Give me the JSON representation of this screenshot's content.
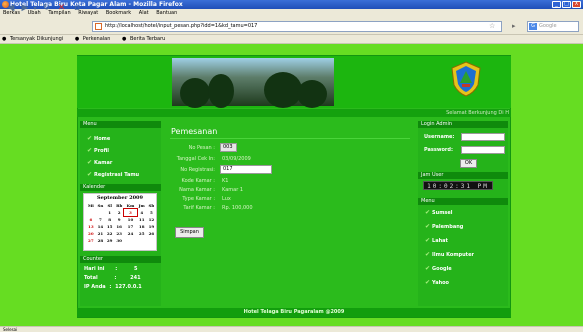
{
  "window": {
    "title": "Hotel Telaga Biru Kota Pagar Alam - Mozilla Firefox",
    "min": "_",
    "max": "□",
    "close": "X"
  },
  "menubar": [
    "Berkas",
    "Ubah",
    "Tampilan",
    "Riwayat",
    "Bookmark",
    "Alat",
    "Bantuan"
  ],
  "nav": {
    "url": "http://localhost/hotel/input_pesan.php?idd=1&kd_tamu=017",
    "search_placeholder": "Google"
  },
  "bookmarks": [
    "Tersanyak Dikunjungi",
    "Perkenalan",
    "Berita Terbaru"
  ],
  "marquee": "Selamat Berkunjung Di H",
  "left_menu": {
    "title": "Menu",
    "items": [
      "Home",
      "Profil",
      "Kamar",
      "Registrasi Tamu"
    ]
  },
  "calendar": {
    "header": "Kalender",
    "month": "September 2009",
    "weekdays": [
      "Mi",
      "Sn",
      "Sl",
      "Rb",
      "Km",
      "Jm",
      "Sb"
    ],
    "weeks": [
      [
        "",
        "",
        "1",
        "2",
        "3",
        "4",
        "5"
      ],
      [
        "6",
        "7",
        "8",
        "9",
        "10",
        "11",
        "12"
      ],
      [
        "13",
        "14",
        "15",
        "16",
        "17",
        "18",
        "19"
      ],
      [
        "20",
        "21",
        "22",
        "23",
        "24",
        "25",
        "26"
      ],
      [
        "27",
        "28",
        "29",
        "30",
        "",
        "",
        ""
      ]
    ],
    "today": "3"
  },
  "counter": {
    "title": "Counter",
    "rows": [
      {
        "label": "Hari ini",
        "sep": ":",
        "value": "5"
      },
      {
        "label": "Total",
        "sep": ":",
        "value": "241"
      },
      {
        "label": "IP Anda",
        "sep": ":",
        "value": "127.0.0.1"
      }
    ]
  },
  "form": {
    "title": "Pemesanan",
    "fields": [
      {
        "label": "No Pesan :",
        "value": "003"
      },
      {
        "label": "Tanggal Cek In:",
        "value": "03/09/2009"
      },
      {
        "label": "No Registrasi:",
        "value": "017"
      },
      {
        "label": "Kode Kamar :",
        "value": "K1"
      },
      {
        "label": "Nama Kamar :",
        "value": "Kamar 1"
      },
      {
        "label": "Type Kamar :",
        "value": "Lux"
      },
      {
        "label": "Tarif Kamar :",
        "value": "Rp. 100,000"
      }
    ],
    "submit": "Simpan"
  },
  "login": {
    "title": "Login Admin",
    "username_label": "Username:",
    "password_label": "Password:",
    "ok": "OK"
  },
  "clock": {
    "title": "Jam User",
    "time": "10:02:31 PM"
  },
  "right_menu": {
    "title": "Menu",
    "items": [
      "Sumsel",
      "Palembang",
      "Lahat",
      "Ilmu Komputer",
      "Google",
      "Yahoo"
    ]
  },
  "footer": "Hotel Telaga Biru Pagaralam @2009",
  "status": "Selesai",
  "colors": {
    "page_bg": "#66dd22",
    "panel": "#25b31a",
    "accent": "#0f8a0c"
  }
}
